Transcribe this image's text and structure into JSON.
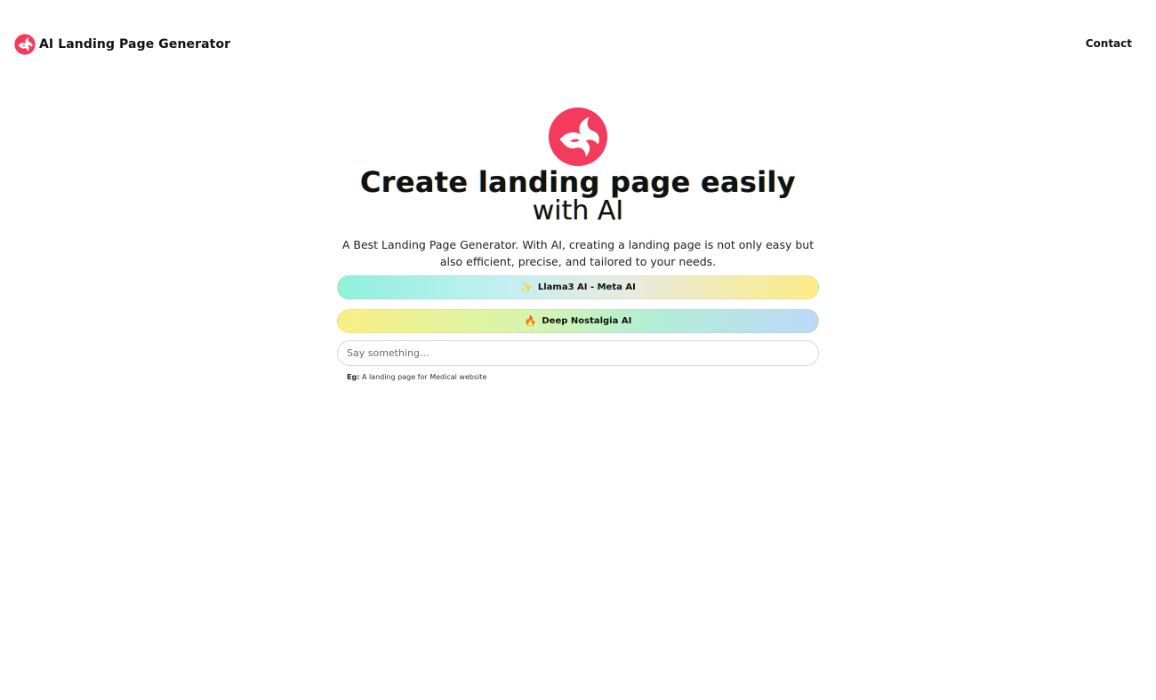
{
  "header": {
    "brand_name": "AI Landing Page Generator",
    "brand_icon": "phoenix-logo-icon",
    "contact_label": "Contact"
  },
  "hero": {
    "logo_icon": "phoenix-logo-icon",
    "title": "Create landing page easily",
    "subtitle": "with AI",
    "description": "A Best Landing Page Generator. With AI, creating a landing page is not only easy but also efficient, precise, and tailored to your needs."
  },
  "models": [
    {
      "icon": "✨",
      "icon_name": "sparkles-icon",
      "label": "Llama3 AI - Meta AI"
    },
    {
      "icon": "🔥",
      "icon_name": "fire-icon",
      "label": "Deep Nostalgia AI"
    }
  ],
  "prompt": {
    "placeholder": "Say something...",
    "value": ""
  },
  "example": {
    "label": "Eg:",
    "text": "A landing page for Medical website"
  },
  "colors": {
    "brand": "#f23b5d",
    "text": "#111111"
  }
}
